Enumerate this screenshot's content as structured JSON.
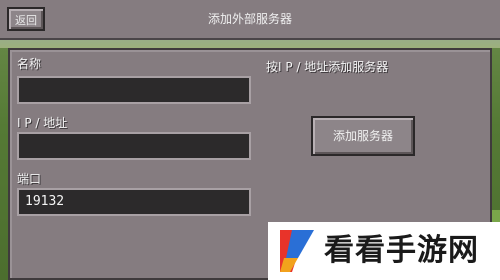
{
  "header": {
    "back_label": "返回",
    "title": "添加外部服务器"
  },
  "form": {
    "name_label": "名称",
    "name_value": "",
    "ip_label": "I P / 地址",
    "ip_value": "",
    "port_label": "端口",
    "port_value": "19132"
  },
  "side": {
    "hint_text": "按I P / 地址添加服务器",
    "add_button_label": "添加服务器"
  },
  "watermark": {
    "text": "看看手游网"
  },
  "colors": {
    "panel": "#857c80",
    "field_bg": "#2c2a2b",
    "text": "#f4f4f4"
  }
}
